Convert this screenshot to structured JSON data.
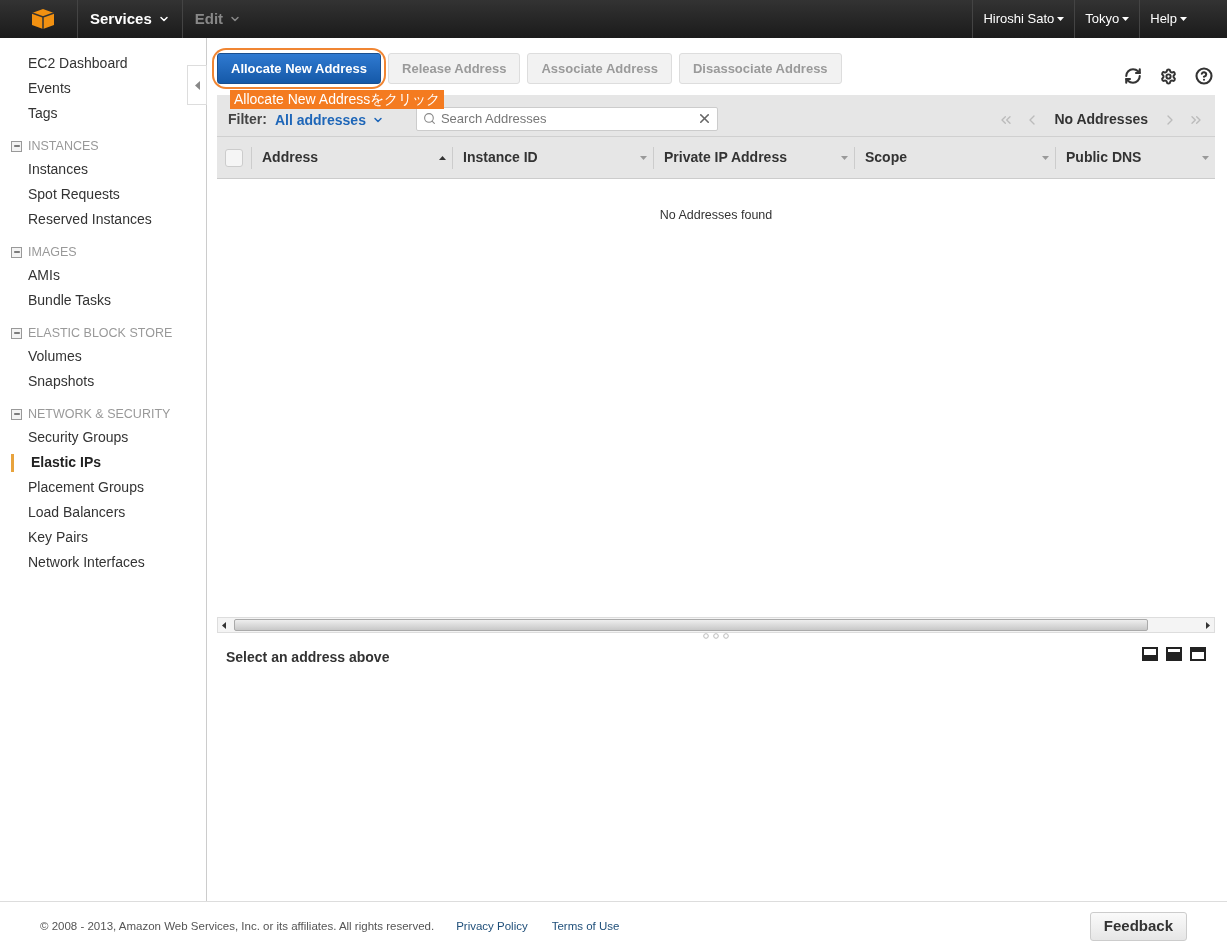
{
  "top_nav": {
    "menus": [
      {
        "label": "Services",
        "disabled": false
      },
      {
        "label": "Edit",
        "disabled": true
      }
    ],
    "right_menus": [
      "Hiroshi Sato",
      "Tokyo",
      "Help"
    ]
  },
  "sidebar": {
    "top_items": [
      {
        "label": "EC2 Dashboard",
        "selected": false
      },
      {
        "label": "Events",
        "selected": false
      },
      {
        "label": "Tags",
        "selected": false
      }
    ],
    "groups": [
      {
        "title": "INSTANCES",
        "expanded": true,
        "items": [
          {
            "label": "Instances",
            "selected": false
          },
          {
            "label": "Spot Requests",
            "selected": false
          },
          {
            "label": "Reserved Instances",
            "selected": false
          }
        ]
      },
      {
        "title": "IMAGES",
        "expanded": true,
        "items": [
          {
            "label": "AMIs",
            "selected": false
          },
          {
            "label": "Bundle Tasks",
            "selected": false
          }
        ]
      },
      {
        "title": "ELASTIC BLOCK STORE",
        "expanded": true,
        "items": [
          {
            "label": "Volumes",
            "selected": false
          },
          {
            "label": "Snapshots",
            "selected": false
          }
        ]
      },
      {
        "title": "NETWORK & SECURITY",
        "expanded": true,
        "items": [
          {
            "label": "Security Groups",
            "selected": false
          },
          {
            "label": "Elastic IPs",
            "selected": true
          },
          {
            "label": "Placement Groups",
            "selected": false
          },
          {
            "label": "Load Balancers",
            "selected": false
          },
          {
            "label": "Key Pairs",
            "selected": false
          },
          {
            "label": "Network Interfaces",
            "selected": false
          }
        ]
      }
    ]
  },
  "toolbar": {
    "buttons": [
      {
        "label": "Allocate New Address",
        "disabled": false,
        "highlighted": true
      },
      {
        "label": "Release Address",
        "disabled": true,
        "highlighted": false
      },
      {
        "label": "Associate Address",
        "disabled": true,
        "highlighted": false
      },
      {
        "label": "Disassociate Address",
        "disabled": true,
        "highlighted": false
      }
    ]
  },
  "annotation": "Allocate New Addressをクリック",
  "filter": {
    "label": "Filter:",
    "value": "All addresses"
  },
  "search": {
    "placeholder": "Search Addresses"
  },
  "pager": "No Addresses",
  "table": {
    "select_all_checked": false,
    "columns": [
      {
        "label": "Address",
        "sorted": true
      },
      {
        "label": "Instance ID",
        "sorted": false
      },
      {
        "label": "Private IP Address",
        "sorted": false
      },
      {
        "label": "Scope",
        "sorted": false
      },
      {
        "label": "Public DNS",
        "sorted": false
      }
    ],
    "empty_message": "No Addresses found"
  },
  "detail": {
    "title": "Select an address above"
  },
  "footer": {
    "copyright": "© 2008 - 2013, Amazon Web Services, Inc. or its affiliates. All rights reserved.",
    "links": [
      "Privacy Policy",
      "Terms of Use"
    ],
    "feedback": "Feedback"
  }
}
